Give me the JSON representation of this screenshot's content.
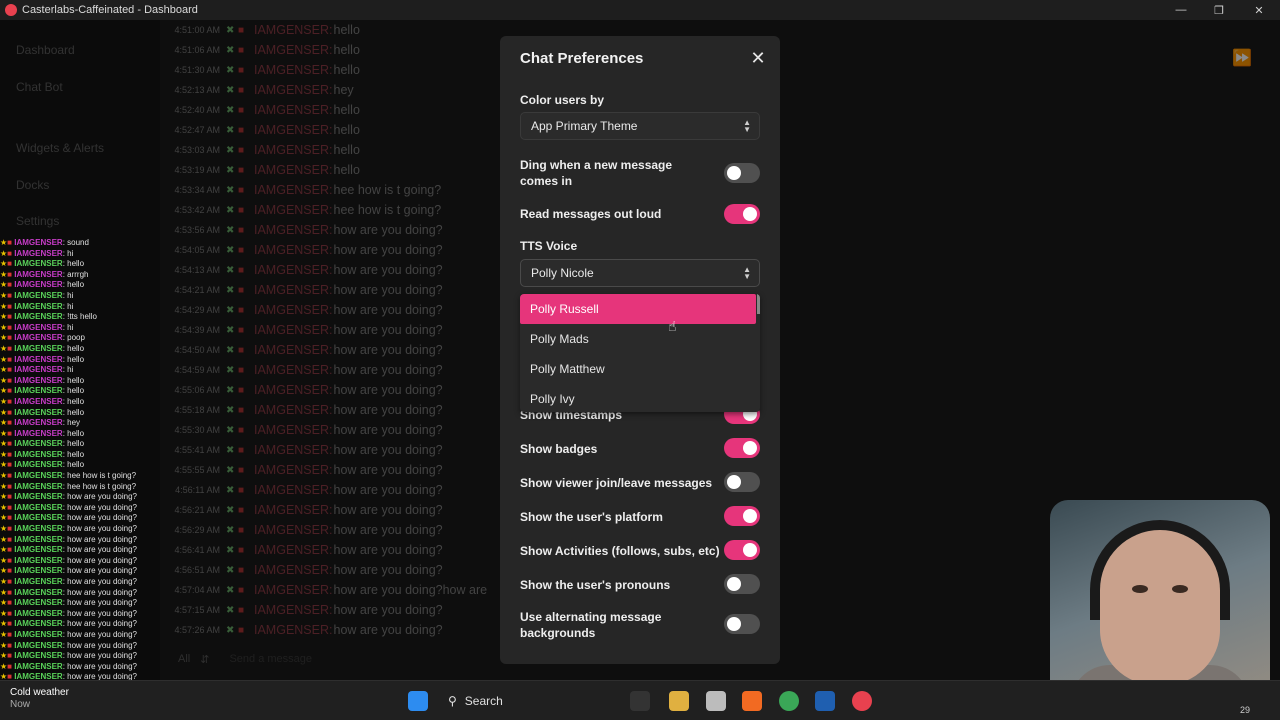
{
  "window": {
    "title": "Casterlabs-Caffeinated - Dashboard"
  },
  "sidebar": {
    "items": [
      {
        "label": "Dashboard"
      },
      {
        "label": "Chat Bot"
      },
      {
        "label": "Widgets & Alerts"
      },
      {
        "label": "Docks"
      },
      {
        "label": "Settings"
      }
    ]
  },
  "chat_log": [
    {
      "time": "4:51:00 AM",
      "name": "IAMGENSER:",
      "msg": "hello"
    },
    {
      "time": "4:51:06 AM",
      "name": "IAMGENSER:",
      "msg": "hello"
    },
    {
      "time": "4:51:30 AM",
      "name": "IAMGENSER:",
      "msg": "hello"
    },
    {
      "time": "4:52:13 AM",
      "name": "IAMGENSER:",
      "msg": "hey"
    },
    {
      "time": "4:52:40 AM",
      "name": "IAMGENSER:",
      "msg": "hello"
    },
    {
      "time": "4:52:47 AM",
      "name": "IAMGENSER:",
      "msg": "hello"
    },
    {
      "time": "4:53:03 AM",
      "name": "IAMGENSER:",
      "msg": "hello"
    },
    {
      "time": "4:53:19 AM",
      "name": "IAMGENSER:",
      "msg": "hello"
    },
    {
      "time": "4:53:34 AM",
      "name": "IAMGENSER:",
      "msg": "hee how is t going?"
    },
    {
      "time": "4:53:42 AM",
      "name": "IAMGENSER:",
      "msg": "hee how is t going?"
    },
    {
      "time": "4:53:56 AM",
      "name": "IAMGENSER:",
      "msg": "how are you doing?"
    },
    {
      "time": "4:54:05 AM",
      "name": "IAMGENSER:",
      "msg": "how are you doing?"
    },
    {
      "time": "4:54:13 AM",
      "name": "IAMGENSER:",
      "msg": "how are you doing?"
    },
    {
      "time": "4:54:21 AM",
      "name": "IAMGENSER:",
      "msg": "how are you doing?"
    },
    {
      "time": "4:54:29 AM",
      "name": "IAMGENSER:",
      "msg": "how are you doing?"
    },
    {
      "time": "4:54:39 AM",
      "name": "IAMGENSER:",
      "msg": "how are you doing?"
    },
    {
      "time": "4:54:50 AM",
      "name": "IAMGENSER:",
      "msg": "how are you doing?"
    },
    {
      "time": "4:54:59 AM",
      "name": "IAMGENSER:",
      "msg": "how are you doing?"
    },
    {
      "time": "4:55:06 AM",
      "name": "IAMGENSER:",
      "msg": "how are you doing?"
    },
    {
      "time": "4:55:18 AM",
      "name": "IAMGENSER:",
      "msg": "how are you doing?"
    },
    {
      "time": "4:55:30 AM",
      "name": "IAMGENSER:",
      "msg": "how are you doing?"
    },
    {
      "time": "4:55:41 AM",
      "name": "IAMGENSER:",
      "msg": "how are you doing?"
    },
    {
      "time": "4:55:55 AM",
      "name": "IAMGENSER:",
      "msg": "how are you doing?"
    },
    {
      "time": "4:56:11 AM",
      "name": "IAMGENSER:",
      "msg": "how are you doing?"
    },
    {
      "time": "4:56:21 AM",
      "name": "IAMGENSER:",
      "msg": "how are you doing?"
    },
    {
      "time": "4:56:29 AM",
      "name": "IAMGENSER:",
      "msg": "how are you doing?"
    },
    {
      "time": "4:56:41 AM",
      "name": "IAMGENSER:",
      "msg": "how are you doing?"
    },
    {
      "time": "4:56:51 AM",
      "name": "IAMGENSER:",
      "msg": "how are you doing?"
    },
    {
      "time": "4:57:04 AM",
      "name": "IAMGENSER:",
      "msg": "how are you doing?how are"
    },
    {
      "time": "4:57:15 AM",
      "name": "IAMGENSER:",
      "msg": "how are you doing?"
    },
    {
      "time": "4:57:26 AM",
      "name": "IAMGENSER:",
      "msg": "how are you doing?"
    }
  ],
  "overlay_chat": [
    {
      "name": "IAMGENSER",
      "msg": ": sound",
      "color": "#c83cc8"
    },
    {
      "name": "IAMGENSER",
      "msg": ": hi",
      "color": "#c83cc8"
    },
    {
      "name": "IAMGENSER",
      "msg": ": hello",
      "color": "#5ad35a"
    },
    {
      "name": "IAMGENSER",
      "msg": ": arrrgh",
      "color": "#c83cc8"
    },
    {
      "name": "IAMGENSER",
      "msg": ": hello",
      "color": "#c83cc8"
    },
    {
      "name": "IAMGENSER",
      "msg": ": hi",
      "color": "#5ad35a"
    },
    {
      "name": "IAMGENSER",
      "msg": ": hi",
      "color": "#5ad35a"
    },
    {
      "name": "IAMGENSER",
      "msg": ": !tts hello",
      "color": "#5ad35a"
    },
    {
      "name": "IAMGENSER",
      "msg": ": hi",
      "color": "#c83cc8"
    },
    {
      "name": "IAMGENSER",
      "msg": ": poop",
      "color": "#c83cc8"
    },
    {
      "name": "IAMGENSER",
      "msg": ": hello",
      "color": "#5ad35a"
    },
    {
      "name": "IAMGENSER",
      "msg": ": hello",
      "color": "#c83cc8"
    },
    {
      "name": "IAMGENSER",
      "msg": ": hi",
      "color": "#c83cc8"
    },
    {
      "name": "IAMGENSER",
      "msg": ": hello",
      "color": "#c83cc8"
    },
    {
      "name": "IAMGENSER",
      "msg": ": hello",
      "color": "#5ad35a"
    },
    {
      "name": "IAMGENSER",
      "msg": ": hello",
      "color": "#c83cc8"
    },
    {
      "name": "IAMGENSER",
      "msg": ": hello",
      "color": "#5ad35a"
    },
    {
      "name": "IAMGENSER",
      "msg": ": hey",
      "color": "#c83cc8"
    },
    {
      "name": "IAMGENSER",
      "msg": ": hello",
      "color": "#c83cc8"
    },
    {
      "name": "IAMGENSER",
      "msg": ": hello",
      "color": "#5ad35a"
    },
    {
      "name": "IAMGENSER",
      "msg": ": hello",
      "color": "#5ad35a"
    },
    {
      "name": "IAMGENSER",
      "msg": ": hello",
      "color": "#5ad35a"
    },
    {
      "name": "IAMGENSER",
      "msg": ": hee how is t going?",
      "color": "#5ad35a"
    },
    {
      "name": "IAMGENSER",
      "msg": ": hee how is t going?",
      "color": "#5ad35a"
    },
    {
      "name": "IAMGENSER",
      "msg": ": how are you doing?",
      "color": "#5ad35a"
    },
    {
      "name": "IAMGENSER",
      "msg": ": how are you doing?",
      "color": "#5ad35a"
    },
    {
      "name": "IAMGENSER",
      "msg": ": how are you doing?",
      "color": "#5ad35a"
    },
    {
      "name": "IAMGENSER",
      "msg": ": how are you doing?",
      "color": "#5ad35a"
    },
    {
      "name": "IAMGENSER",
      "msg": ": how are you doing?",
      "color": "#5ad35a"
    },
    {
      "name": "IAMGENSER",
      "msg": ": how are you doing?",
      "color": "#5ad35a"
    },
    {
      "name": "IAMGENSER",
      "msg": ": how are you doing?",
      "color": "#5ad35a"
    },
    {
      "name": "IAMGENSER",
      "msg": ": how are you doing?",
      "color": "#5ad35a"
    },
    {
      "name": "IAMGENSER",
      "msg": ": how are you doing?",
      "color": "#5ad35a"
    },
    {
      "name": "IAMGENSER",
      "msg": ": how are you doing?",
      "color": "#5ad35a"
    },
    {
      "name": "IAMGENSER",
      "msg": ": how are you doing?",
      "color": "#5ad35a"
    },
    {
      "name": "IAMGENSER",
      "msg": ": how are you doing?",
      "color": "#5ad35a"
    },
    {
      "name": "IAMGENSER",
      "msg": ": how are you doing?",
      "color": "#5ad35a"
    },
    {
      "name": "IAMGENSER",
      "msg": ": how are you doing?",
      "color": "#5ad35a"
    },
    {
      "name": "IAMGENSER",
      "msg": ": how are you doing?",
      "color": "#5ad35a"
    },
    {
      "name": "IAMGENSER",
      "msg": ": how are you doing?",
      "color": "#5ad35a"
    },
    {
      "name": "IAMGENSER",
      "msg": ": how are you doing?",
      "color": "#5ad35a"
    },
    {
      "name": "IAMGENSER",
      "msg": ": how are you doing?",
      "color": "#5ad35a"
    }
  ],
  "chat_footer": {
    "filter": "All",
    "placeholder": "Send a message"
  },
  "modal": {
    "title": "Chat Preferences",
    "color_users_by": {
      "label": "Color users by",
      "value": "App Primary Theme"
    },
    "ding": {
      "label": "Ding when a new message comes in",
      "on": false
    },
    "read_aloud": {
      "label": "Read messages out loud",
      "on": true
    },
    "tts_voice": {
      "label": "TTS Voice",
      "value": "Polly Nicole",
      "options": [
        "Polly Russell",
        "Polly Mads",
        "Polly Matthew",
        "Polly Ivy"
      ],
      "highlighted": "Polly Russell"
    },
    "toggles": [
      {
        "label": "Show timestamps",
        "on": true
      },
      {
        "label": "Show badges",
        "on": true
      },
      {
        "label": "Show viewer join/leave messages",
        "on": false
      },
      {
        "label": "Show the user's platform",
        "on": true
      },
      {
        "label": "Show Activities (follows, subs, etc)",
        "on": true
      },
      {
        "label": "Show the user's pronouns",
        "on": false
      },
      {
        "label": "Use alternating message backgrounds",
        "on": false
      }
    ]
  },
  "taskbar": {
    "search_label": "Search",
    "weather_title": "Cold weather",
    "weather_sub": "Now",
    "clock_date": "29"
  },
  "colors": {
    "accent": "#e6357b",
    "name_color": "#8a3a44"
  }
}
